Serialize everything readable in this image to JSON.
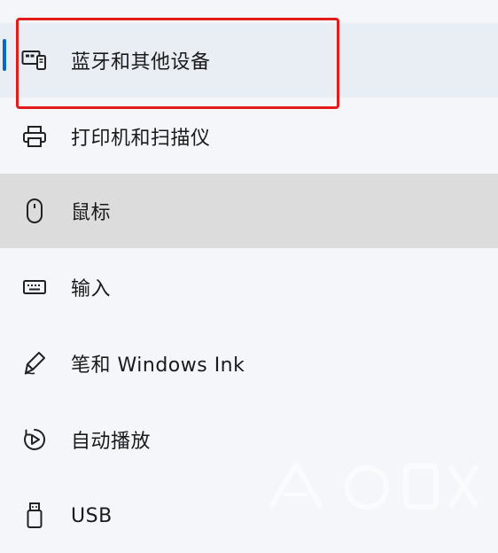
{
  "colors": {
    "accent": "#0a67c8",
    "highlight_border": "#e21b1b",
    "selected_bg": "#e9eef4",
    "hover_bg": "#dcdcdc"
  },
  "nav": {
    "items": [
      {
        "label": "蓝牙和其他设备",
        "icon": "devices-icon"
      },
      {
        "label": "打印机和扫描仪",
        "icon": "printer-icon"
      },
      {
        "label": "鼠标",
        "icon": "mouse-icon"
      },
      {
        "label": "输入",
        "icon": "keyboard-icon"
      },
      {
        "label": "笔和 Windows Ink",
        "icon": "pen-icon"
      },
      {
        "label": "自动播放",
        "icon": "autoplay-icon"
      },
      {
        "label": "USB",
        "icon": "usb-icon"
      }
    ]
  }
}
